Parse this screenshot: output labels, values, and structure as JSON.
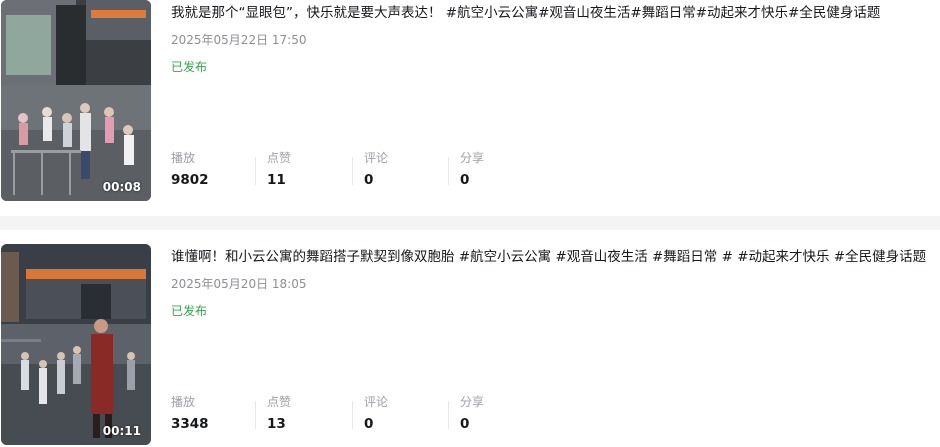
{
  "videos": [
    {
      "title": "我就是那个“显眼包”，快乐就是要大声表达！ #航空小云公寓#观音山夜生活#舞蹈日常#动起来才快乐#全民健身话题",
      "publish_time": "2025年05月22日 17:50",
      "status": "已发布",
      "duration": "00:08",
      "stats": {
        "plays_label": "播放",
        "plays": "9802",
        "likes_label": "点赞",
        "likes": "11",
        "comments_label": "评论",
        "comments": "0",
        "shares_label": "分享",
        "shares": "0"
      }
    },
    {
      "title": "谁懂啊！和小云公寓的舞蹈搭子默契到像双胞胎 #航空小云公寓 #观音山夜生活 #舞蹈日常 # #动起来才快乐 #全民健身话题",
      "publish_time": "2025年05月20日 18:05",
      "status": "已发布",
      "duration": "00:11",
      "stats": {
        "plays_label": "播放",
        "plays": "3348",
        "likes_label": "点赞",
        "likes": "13",
        "comments_label": "评论",
        "comments": "0",
        "shares_label": "分享",
        "shares": "0"
      }
    }
  ],
  "colors": {
    "status_green": "#36a54a",
    "muted_text": "#8d8f95",
    "separator": "#f4f4f6"
  }
}
